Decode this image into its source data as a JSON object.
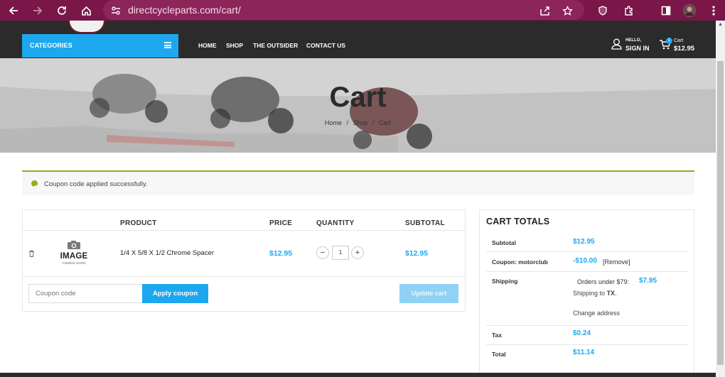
{
  "browser": {
    "url": "directcycleparts.com/cart/"
  },
  "store_nav": {
    "categories_label": "CATEGORIES",
    "menu": [
      "HOME",
      "SHOP",
      "THE OUTSIDER",
      "CONTACT US"
    ],
    "signin_small": "HELLO,",
    "signin_big": "SIGN IN",
    "cart_count": "1",
    "cart_small": "Cart",
    "cart_total": "$12.95"
  },
  "hero": {
    "title": "Cart",
    "breadcrumb": [
      "Home",
      "Shop",
      "Cart"
    ],
    "sep": "/"
  },
  "notice": {
    "text": "Coupon code applied successfully."
  },
  "cart_table": {
    "headers": {
      "product": "PRODUCT",
      "price": "PRICE",
      "quantity": "QUANTITY",
      "subtotal": "SUBTOTAL"
    },
    "items": [
      {
        "image_text": "IMAGE",
        "image_subtext": "COMING SOON",
        "name": "1/4 X 5/8 X 1/2 Chrome Spacer",
        "price": "$12.95",
        "quantity": "1",
        "subtotal": "$12.95"
      }
    ],
    "coupon_placeholder": "Coupon code",
    "apply_coupon": "Apply coupon",
    "update_cart": "Update cart"
  },
  "totals": {
    "title": "CART TOTALS",
    "subtotal_label": "Subtotal",
    "subtotal_value": "$12.95",
    "coupon_label": "Coupon: motorclub",
    "coupon_value": "-$10.00",
    "coupon_remove": "[Remove]",
    "shipping_label": "Shipping",
    "shipping_method": "Orders under $79:",
    "shipping_cost": "$7.95",
    "shipping_to": "Shipping to",
    "shipping_state": "TX",
    "change_address": "Change address",
    "tax_label": "Tax",
    "tax_value": "$0.24",
    "total_label": "Total",
    "total_value": "$11.14"
  },
  "colors": {
    "chrome": "#7a1648",
    "accent": "#1da7ef",
    "success": "#8fae1b",
    "nav_dark": "#2b2b2b"
  }
}
